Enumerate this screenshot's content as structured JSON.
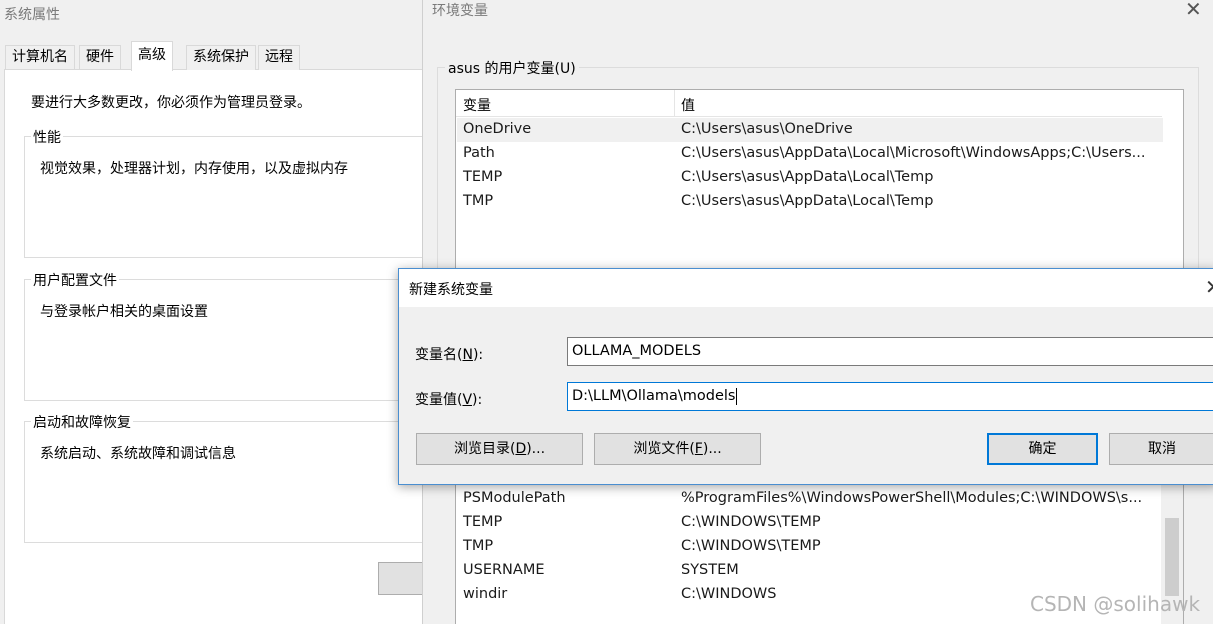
{
  "sys_props": {
    "title": "系统属性",
    "tabs": [
      {
        "label": "计算机名"
      },
      {
        "label": "硬件"
      },
      {
        "label": "高级"
      },
      {
        "label": "系统保护"
      },
      {
        "label": "远程"
      }
    ],
    "notice": "要进行大多数更改，你必须作为管理员登录。",
    "groups": [
      {
        "title": "性能",
        "desc": "视觉效果，处理器计划，内存使用，以及虚拟内存"
      },
      {
        "title": "用户配置文件",
        "desc": "与登录帐户相关的桌面设置"
      },
      {
        "title": "启动和故障恢复",
        "desc": "系统启动、系统故障和调试信息"
      }
    ]
  },
  "env_vars": {
    "title": "环境变量",
    "user_section_title": "asus 的用户变量(U)",
    "columns": {
      "name": "变量",
      "value": "值"
    },
    "user_vars": [
      {
        "name": "OneDrive",
        "value": "C:\\Users\\asus\\OneDrive"
      },
      {
        "name": "Path",
        "value": "C:\\Users\\asus\\AppData\\Local\\Microsoft\\WindowsApps;C:\\Users..."
      },
      {
        "name": "TEMP",
        "value": "C:\\Users\\asus\\AppData\\Local\\Temp"
      },
      {
        "name": "TMP",
        "value": "C:\\Users\\asus\\AppData\\Local\\Temp"
      }
    ],
    "sys_vars": [
      {
        "name": "PSModulePath",
        "value": "%ProgramFiles%\\WindowsPowerShell\\Modules;C:\\WINDOWS\\s..."
      },
      {
        "name": "TEMP",
        "value": "C:\\WINDOWS\\TEMP"
      },
      {
        "name": "TMP",
        "value": "C:\\WINDOWS\\TEMP"
      },
      {
        "name": "USERNAME",
        "value": "SYSTEM"
      },
      {
        "name": "windir",
        "value": "C:\\WINDOWS"
      }
    ]
  },
  "new_var_dialog": {
    "title": "新建系统变量",
    "name_label": "变量名(",
    "name_label_key": "N",
    "name_label_end": "):",
    "value_label": "变量值(",
    "value_label_key": "V",
    "value_label_end": "):",
    "name_value": "OLLAMA_MODELS",
    "value_value": "D:\\LLM\\Ollama\\models",
    "browse_dir": "浏览目录(",
    "browse_dir_key": "D",
    "browse_dir_end": ")...",
    "browse_file": "浏览文件(",
    "browse_file_key": "F",
    "browse_file_end": ")...",
    "ok": "确定",
    "cancel": "取消"
  },
  "watermark": "CSDN @solihawk",
  "icons": {
    "close": "close-icon"
  }
}
